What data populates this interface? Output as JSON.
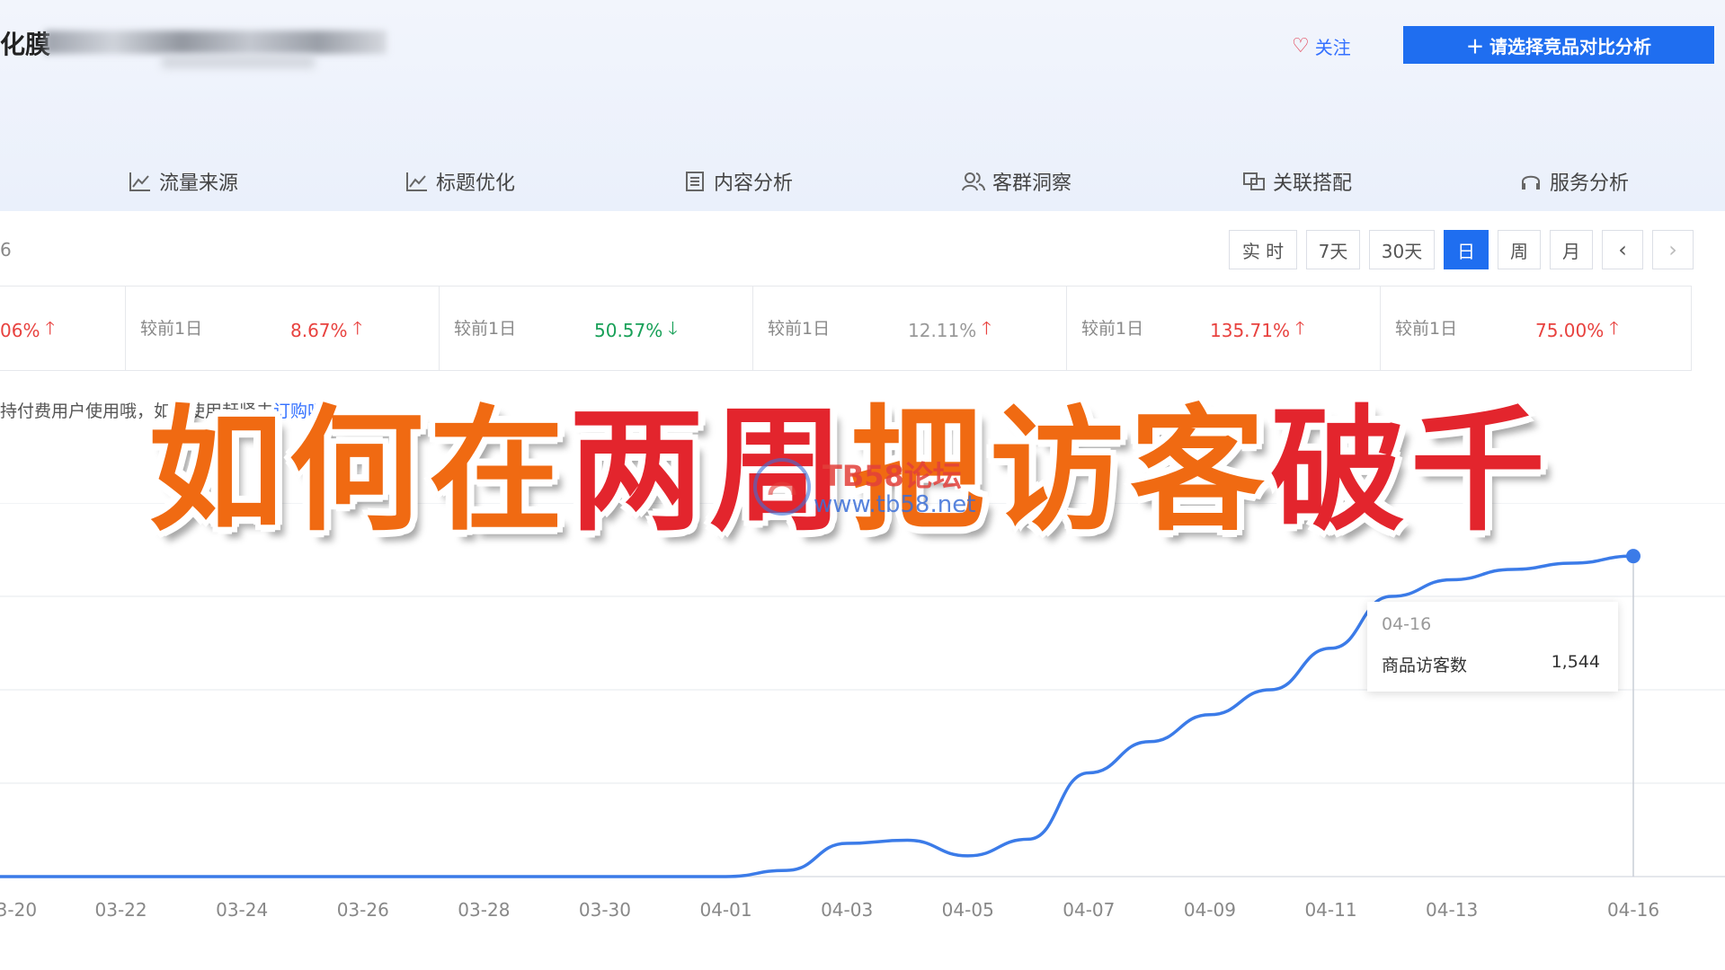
{
  "header": {
    "product_title": "化膜",
    "follow_label": "关注",
    "compare_label": "请选择竞品对比分析"
  },
  "tabs": [
    {
      "label": "流量来源",
      "icon": "line-chart-icon"
    },
    {
      "label": "标题优化",
      "icon": "line-chart-icon"
    },
    {
      "label": "内容分析",
      "icon": "document-icon"
    },
    {
      "label": "客群洞察",
      "icon": "users-icon"
    },
    {
      "label": "关联搭配",
      "icon": "link-box-icon"
    },
    {
      "label": "服务分析",
      "icon": "headset-icon"
    }
  ],
  "toolbar": {
    "left_fragment": "6",
    "periods": [
      "实 时",
      "7天",
      "30天",
      "日",
      "周",
      "月"
    ],
    "active_period": "日"
  },
  "stats": [
    {
      "label": "",
      "value": "06%",
      "dir": "up"
    },
    {
      "label": "较前1日",
      "value": "8.67%",
      "dir": "up"
    },
    {
      "label": "较前1日",
      "value": "50.57%",
      "dir": "down"
    },
    {
      "label": "较前1日",
      "value": "12.11%",
      "dir": "up"
    },
    {
      "label": "较前1日",
      "value": "135.71%",
      "dir": "up"
    },
    {
      "label": "较前1日",
      "value": "75.00%",
      "dir": "up"
    }
  ],
  "notice": {
    "text": "持付费用户使用哦，如需使用赶紧去",
    "link": "订购吧"
  },
  "overlay": {
    "part1": "如何在",
    "part2": "两周",
    "part3": "把访客",
    "part4": "破千"
  },
  "watermark": {
    "line1": "TB58论坛",
    "line2": "www.tb58.net"
  },
  "tooltip": {
    "date": "04-16",
    "label": "商品访客数",
    "value": "1,544"
  },
  "colors": {
    "accent": "#1f6ef0",
    "up": "#e8423f",
    "down": "#18a058",
    "line": "#3b7be8"
  },
  "chart_data": {
    "type": "line",
    "x": [
      "03-20",
      "03-21",
      "03-22",
      "03-23",
      "03-24",
      "03-25",
      "03-26",
      "03-27",
      "03-28",
      "03-29",
      "03-30",
      "03-31",
      "04-01",
      "04-02",
      "04-03",
      "04-04",
      "04-05",
      "04-06",
      "04-07",
      "04-08",
      "04-09",
      "04-10",
      "04-11",
      "04-12",
      "04-13",
      "04-14",
      "04-15",
      "04-16"
    ],
    "x_tick_labels": [
      "03-20",
      "03-22",
      "03-24",
      "03-26",
      "03-28",
      "03-30",
      "04-01",
      "04-03",
      "04-05",
      "04-07",
      "04-09",
      "04-11",
      "04-13",
      "04-16"
    ],
    "series": [
      {
        "name": "商品访客数",
        "values": [
          0,
          0,
          0,
          0,
          0,
          0,
          0,
          0,
          0,
          0,
          0,
          0,
          0,
          30,
          160,
          175,
          100,
          180,
          500,
          650,
          780,
          900,
          1100,
          1350,
          1430,
          1480,
          1510,
          1544
        ]
      }
    ],
    "ylim": [
      0,
      1800
    ],
    "grid": true,
    "highlight": {
      "x": "04-16",
      "value": 1544
    }
  }
}
